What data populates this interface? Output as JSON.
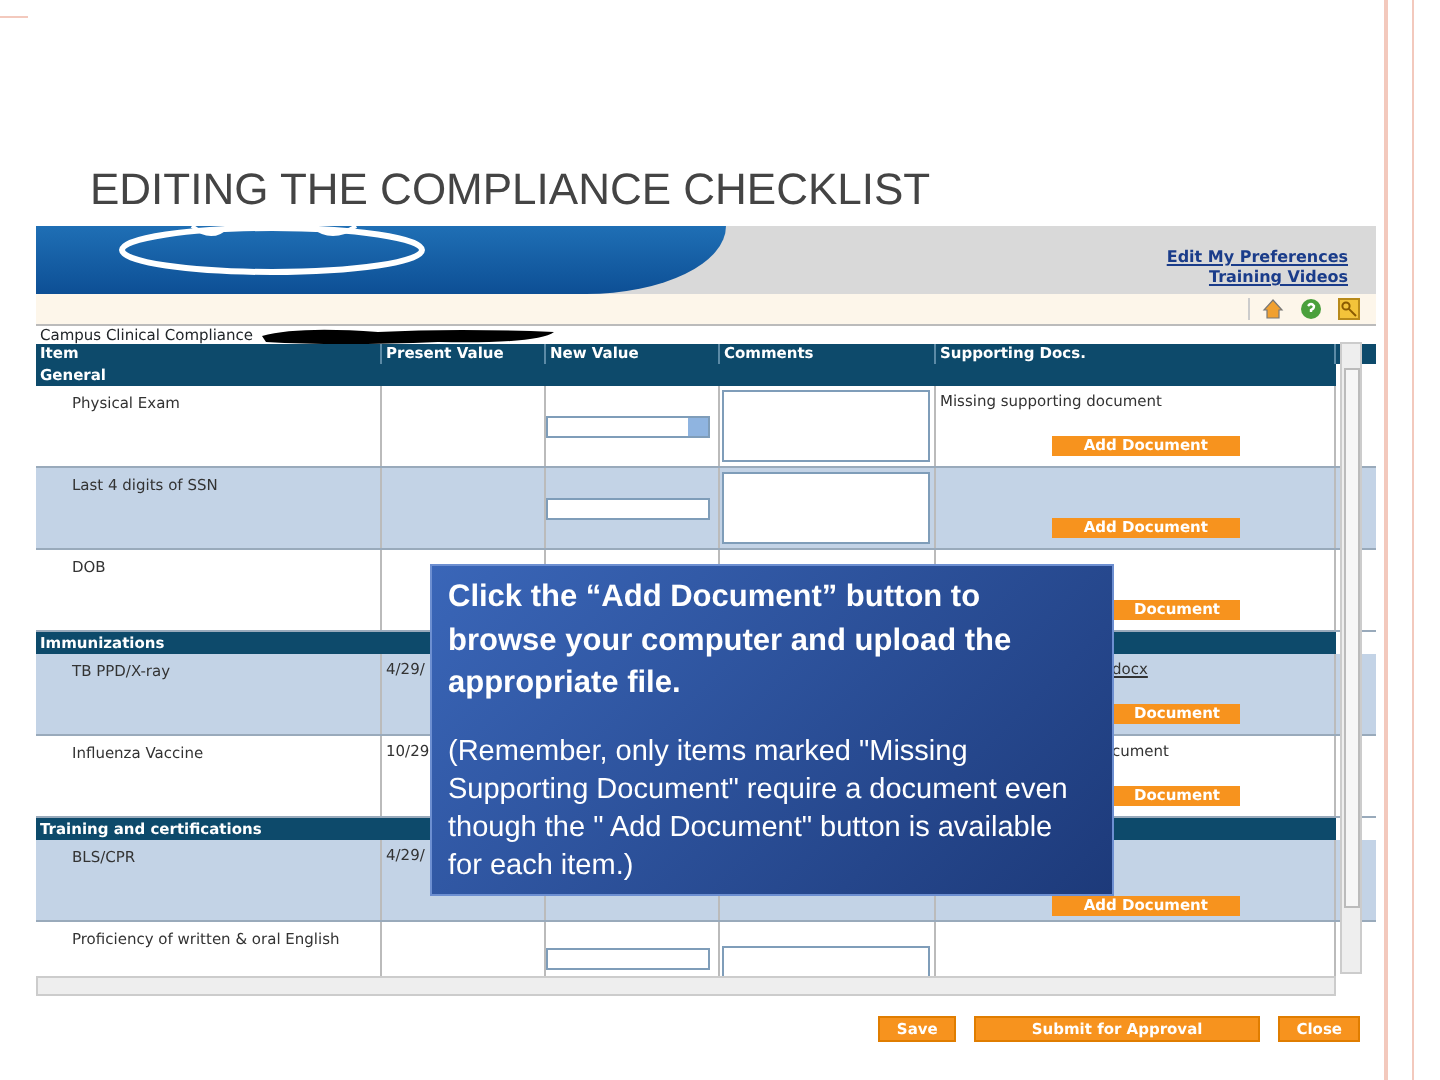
{
  "slide_title": "EDITING THE COMPLIANCE CHECKLIST",
  "header": {
    "links": [
      "Edit My Preferences",
      "Training Videos"
    ]
  },
  "caption": "Campus Clinical Compliance",
  "table": {
    "columns": [
      "Item",
      "Present Value",
      "New Value",
      "Comments",
      "Supporting Docs."
    ],
    "groups": [
      {
        "title": "General",
        "rows": [
          {
            "kind": "open",
            "item": "Physical Exam",
            "new_value": {
              "kind": "select"
            },
            "doc_text": "Missing supporting document",
            "button": "Add Document"
          },
          {
            "kind": "open",
            "item": "Last 4 digits of SSN",
            "new_value": {
              "kind": "text"
            },
            "button": "Add Document"
          },
          {
            "kind": "covered",
            "item": "DOB",
            "button": "Document"
          }
        ]
      },
      {
        "title": "Immunizations",
        "rows": [
          {
            "kind": "covered",
            "item": "TB PPD/X-ray",
            "present": "4/29/",
            "doc_link": "docx",
            "button": "Document"
          },
          {
            "kind": "covered",
            "item": "Influenza Vaccine",
            "present": "10/29",
            "doc_text": "cument",
            "button": "Document"
          }
        ]
      },
      {
        "title": "Training and certifications",
        "rows": [
          {
            "kind": "lower",
            "item": "BLS/CPR",
            "present": "4/29/",
            "button": "Add Document"
          },
          {
            "kind": "cut",
            "item": "Proficiency of written & oral English",
            "new_value": {
              "kind": "text"
            }
          }
        ]
      }
    ]
  },
  "callout": {
    "heading": "Click the “Add Document” button to browse your computer and upload the appropriate file.",
    "note": "(Remember, only items marked \"Missing Supporting Document\" require a document even though the \" Add Document\" button is available for each item.)"
  },
  "actions": [
    "Save",
    "Submit for Approval",
    "Close"
  ]
}
